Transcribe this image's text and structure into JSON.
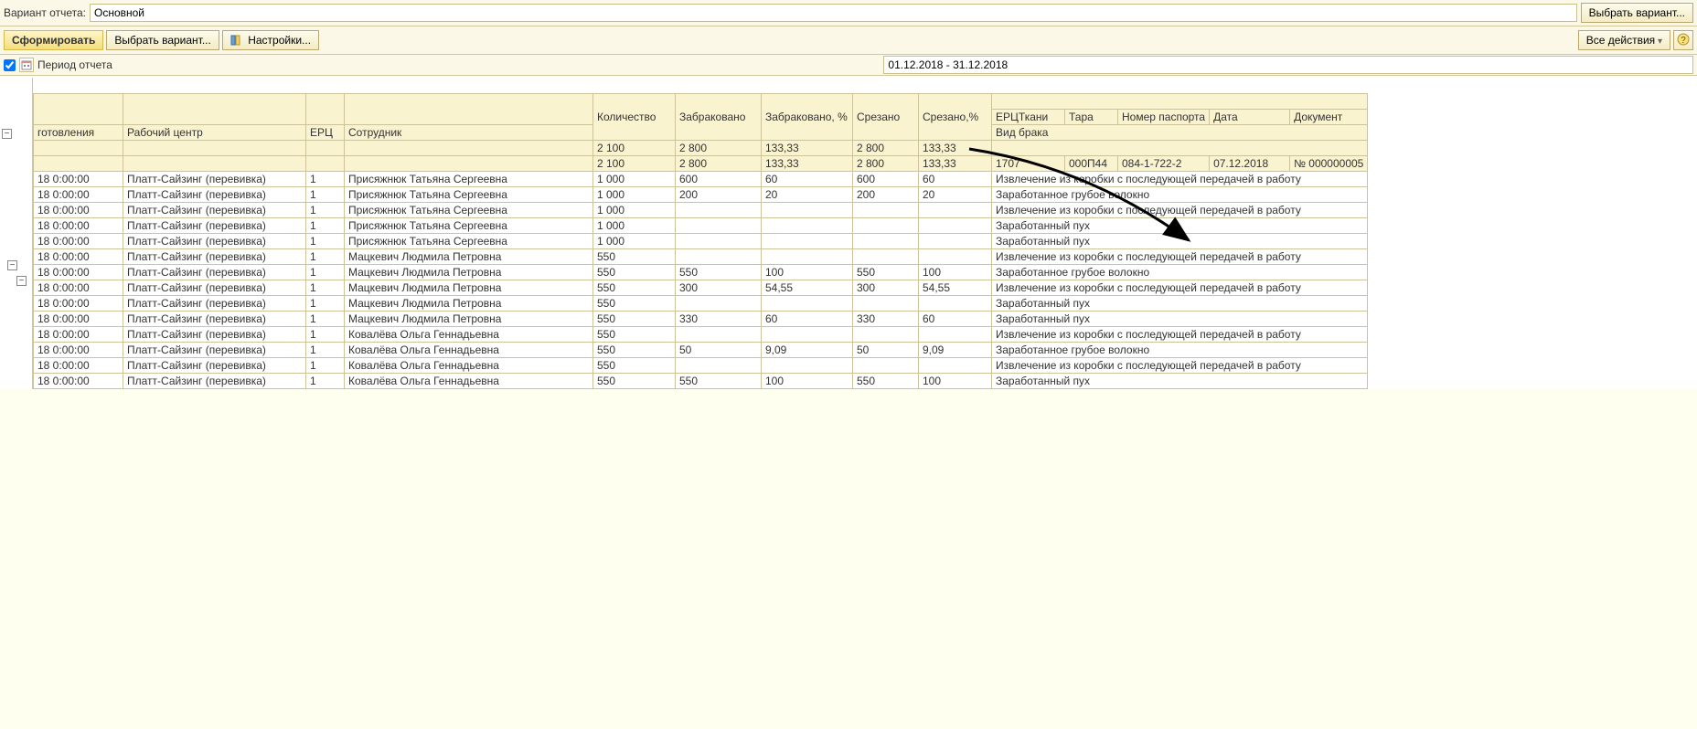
{
  "topbar": {
    "variant_label": "Вариант отчета:",
    "variant_value": "Основной",
    "choose_variant_btn": "Выбрать вариант..."
  },
  "toolbar": {
    "form_btn": "Сформировать",
    "choose_variant": "Выбрать вариант...",
    "settings": "Настройки...",
    "all_actions": "Все действия"
  },
  "period": {
    "label": "Период отчета",
    "value": "01.12.2018 - 31.12.2018"
  },
  "headers": {
    "row1": {
      "qty": "Количество",
      "rej": "Забраковано",
      "rejp": "Забраковано, %",
      "cut": "Срезано",
      "cutp": "Срезано,%",
      "erc_tkani": "ЕРЦТкани",
      "tara": "Тара",
      "passport": "Номер паспорта",
      "date": "Дата",
      "doc": "Документ"
    },
    "row2": {
      "gotov": "готовления",
      "center": "Рабочий центр",
      "erc": "ЕРЦ",
      "emp": "Сотрудник",
      "vid_braka": "Вид брака"
    }
  },
  "totals": {
    "r1": {
      "qty": "2 100",
      "rej": "2 800",
      "rejp": "133,33",
      "cut": "2 800",
      "cutp": "133,33"
    },
    "r2": {
      "qty": "2 100",
      "rej": "2 800",
      "rejp": "133,33",
      "cut": "2 800",
      "cutp": "133,33",
      "erct": "1707",
      "tara": "000П44",
      "pass": "084-1-722-2",
      "date": "07.12.2018",
      "doc": "№ 000000005"
    }
  },
  "rows": [
    {
      "d": "18 0:00:00",
      "c": "Платт-Сайзинг (перевивка)",
      "e": "1",
      "emp": "Присяжнюк Татьяна Сергеевна",
      "qty": "1 000",
      "rej": "600",
      "rejp": "60",
      "cut": "600",
      "cutp": "60",
      "txt": "Извлечение из коробки с последующей передачей в работу"
    },
    {
      "d": "18 0:00:00",
      "c": "Платт-Сайзинг (перевивка)",
      "e": "1",
      "emp": "Присяжнюк Татьяна Сергеевна",
      "qty": "1 000",
      "rej": "200",
      "rejp": "20",
      "cut": "200",
      "cutp": "20",
      "txt": "Заработанное грубое волокно"
    },
    {
      "d": "18 0:00:00",
      "c": "Платт-Сайзинг (перевивка)",
      "e": "1",
      "emp": "Присяжнюк Татьяна Сергеевна",
      "qty": "1 000",
      "rej": "",
      "rejp": "",
      "cut": "",
      "cutp": "",
      "txt": "Извлечение из коробки с последующей передачей в работу"
    },
    {
      "d": "18 0:00:00",
      "c": "Платт-Сайзинг (перевивка)",
      "e": "1",
      "emp": "Присяжнюк Татьяна Сергеевна",
      "qty": "1 000",
      "rej": "",
      "rejp": "",
      "cut": "",
      "cutp": "",
      "txt": "Заработанный пух"
    },
    {
      "d": "18 0:00:00",
      "c": "Платт-Сайзинг (перевивка)",
      "e": "1",
      "emp": "Присяжнюк Татьяна Сергеевна",
      "qty": "1 000",
      "rej": "",
      "rejp": "",
      "cut": "",
      "cutp": "",
      "txt": "Заработанный пух"
    },
    {
      "d": "18 0:00:00",
      "c": "Платт-Сайзинг (перевивка)",
      "e": "1",
      "emp": "Мацкевич Людмила Петровна",
      "qty": "550",
      "rej": "",
      "rejp": "",
      "cut": "",
      "cutp": "",
      "txt": "Извлечение из коробки с последующей передачей в работу"
    },
    {
      "d": "18 0:00:00",
      "c": "Платт-Сайзинг (перевивка)",
      "e": "1",
      "emp": "Мацкевич Людмила Петровна",
      "qty": "550",
      "rej": "550",
      "rejp": "100",
      "cut": "550",
      "cutp": "100",
      "txt": "Заработанное грубое волокно"
    },
    {
      "d": "18 0:00:00",
      "c": "Платт-Сайзинг (перевивка)",
      "e": "1",
      "emp": "Мацкевич Людмила Петровна",
      "qty": "550",
      "rej": "300",
      "rejp": "54,55",
      "cut": "300",
      "cutp": "54,55",
      "txt": "Извлечение из коробки с последующей передачей в работу"
    },
    {
      "d": "18 0:00:00",
      "c": "Платт-Сайзинг (перевивка)",
      "e": "1",
      "emp": "Мацкевич Людмила Петровна",
      "qty": "550",
      "rej": "",
      "rejp": "",
      "cut": "",
      "cutp": "",
      "txt": "Заработанный пух"
    },
    {
      "d": "18 0:00:00",
      "c": "Платт-Сайзинг (перевивка)",
      "e": "1",
      "emp": "Мацкевич Людмила Петровна",
      "qty": "550",
      "rej": "330",
      "rejp": "60",
      "cut": "330",
      "cutp": "60",
      "txt": "Заработанный пух"
    },
    {
      "d": "18 0:00:00",
      "c": "Платт-Сайзинг (перевивка)",
      "e": "1",
      "emp": "Ковалёва Ольга Геннадьевна",
      "qty": "550",
      "rej": "",
      "rejp": "",
      "cut": "",
      "cutp": "",
      "txt": "Извлечение из коробки с последующей передачей в работу"
    },
    {
      "d": "18 0:00:00",
      "c": "Платт-Сайзинг (перевивка)",
      "e": "1",
      "emp": "Ковалёва Ольга Геннадьевна",
      "qty": "550",
      "rej": "50",
      "rejp": "9,09",
      "cut": "50",
      "cutp": "9,09",
      "txt": "Заработанное грубое волокно"
    },
    {
      "d": "18 0:00:00",
      "c": "Платт-Сайзинг (перевивка)",
      "e": "1",
      "emp": "Ковалёва Ольга Геннадьевна",
      "qty": "550",
      "rej": "",
      "rejp": "",
      "cut": "",
      "cutp": "",
      "txt": "Извлечение из коробки с последующей передачей в работу"
    },
    {
      "d": "18 0:00:00",
      "c": "Платт-Сайзинг (перевивка)",
      "e": "1",
      "emp": "Ковалёва Ольга Геннадьевна",
      "qty": "550",
      "rej": "550",
      "rejp": "100",
      "cut": "550",
      "cutp": "100",
      "txt": "Заработанный пух"
    }
  ]
}
